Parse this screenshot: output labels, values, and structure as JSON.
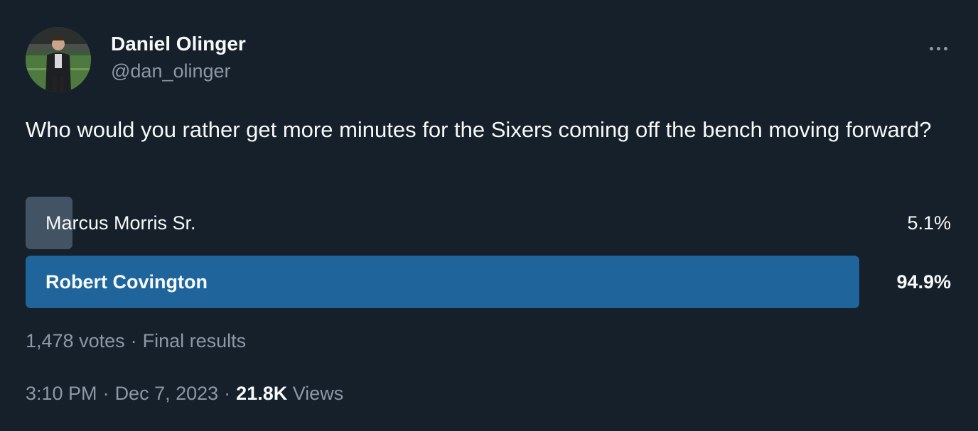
{
  "author": {
    "display_name": "Daniel Olinger",
    "handle": "@dan_olinger"
  },
  "tweet": {
    "text": "Who would you rather get more minutes for the Sixers coming off the bench moving forward?"
  },
  "poll": {
    "options": [
      {
        "label": "Marcus Morris Sr.",
        "percent_text": "5.1%",
        "percent": 5.1,
        "winner": false
      },
      {
        "label": "Robert Covington",
        "percent_text": "94.9%",
        "percent": 94.9,
        "winner": true
      }
    ],
    "votes": "1,478 votes",
    "separator": "·",
    "status": "Final results"
  },
  "meta": {
    "time": "3:10 PM",
    "separator": "·",
    "date": "Dec 7, 2023",
    "views_count": "21.8K",
    "views_label": "Views"
  },
  "icons": {
    "more": "more-horizontal-icon"
  },
  "colors": {
    "background": "#15202b",
    "text_primary": "#f7f9f9",
    "text_secondary": "#8b98a5",
    "poll_winner": "#1f659c",
    "poll_other": "#425364"
  }
}
